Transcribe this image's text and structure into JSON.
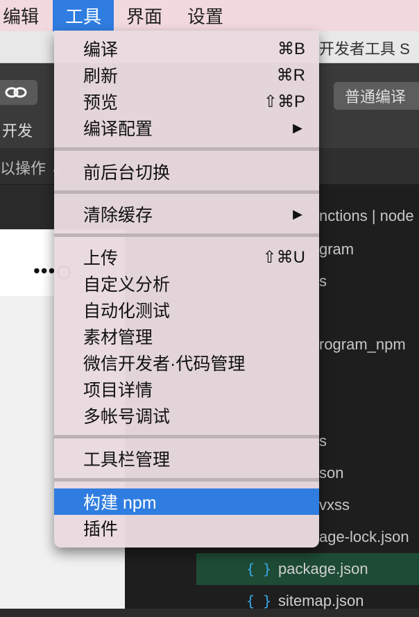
{
  "menubar": {
    "items": [
      "编辑",
      "工具",
      "界面",
      "设置"
    ]
  },
  "window": {
    "title": "开发者工具 S",
    "toolbar": {
      "dev_label": "开发",
      "compile_button": "普通编译"
    },
    "subbar": {
      "simulate_action": "以操作 ⌄"
    },
    "file_tree": [
      "nctions | node",
      "gram",
      "s",
      "rogram_npm",
      "s",
      "son",
      "vxss",
      "age-lock.json"
    ],
    "json_files": [
      {
        "icon": "{ }",
        "name": "package.json"
      },
      {
        "icon": "{ }",
        "name": "sitemap.json"
      }
    ]
  },
  "menu": {
    "items": [
      {
        "label": "编译",
        "shortcut": "⌘B"
      },
      {
        "label": "刷新",
        "shortcut": "⌘R"
      },
      {
        "label": "预览",
        "shortcut": "⇧⌘P"
      },
      {
        "label": "编译配置",
        "shortcut": "▶"
      },
      {
        "label": "前后台切换",
        "shortcut": ""
      },
      {
        "label": "清除缓存",
        "shortcut": "▶"
      },
      {
        "label": "上传",
        "shortcut": "⇧⌘U"
      },
      {
        "label": "自定义分析",
        "shortcut": ""
      },
      {
        "label": "自动化测试",
        "shortcut": ""
      },
      {
        "label": "素材管理",
        "shortcut": ""
      },
      {
        "label": "微信开发者·代码管理",
        "shortcut": ""
      },
      {
        "label": "项目详情",
        "shortcut": ""
      },
      {
        "label": "多帐号调试",
        "shortcut": ""
      },
      {
        "label": "工具栏管理",
        "shortcut": ""
      },
      {
        "label": "构建 npm",
        "shortcut": ""
      },
      {
        "label": "插件",
        "shortcut": ""
      }
    ],
    "highlighted_index": 14
  },
  "colors": {
    "menubar_bg": "#f2d9de",
    "accent": "#2f7de0",
    "json_icon": "#39a9e8"
  }
}
